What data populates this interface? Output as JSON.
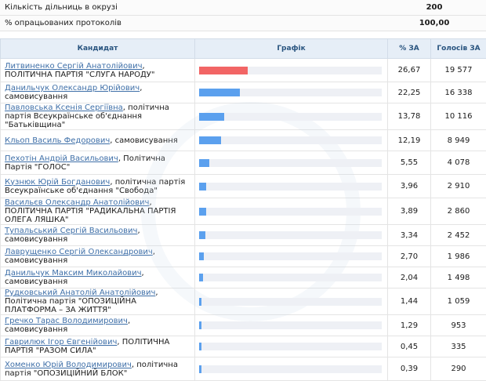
{
  "summary": [
    {
      "label": "Кількість дільниць в окрузі",
      "value": "200"
    },
    {
      "label": "% опрацьованих протоколів",
      "value": "100,00"
    }
  ],
  "table": {
    "headers": {
      "candidate": "Кандидат",
      "chart": "Графік",
      "pct": "% ЗА",
      "votes": "Голосів ЗА"
    },
    "rows": [
      {
        "name": "Литвиненко Сергій Анатолійович",
        "affil": ", ПОЛІТИЧНА ПАРТІЯ \"СЛУГА НАРОДУ\"",
        "pct": "26,67",
        "votes": "19 577",
        "share": 26.67
      },
      {
        "name": "Данильчук Олександр Юрійович",
        "affil": ", самовисування",
        "pct": "22,25",
        "votes": "16 338",
        "share": 22.25
      },
      {
        "name": "Павловська Ксенія Сергіївна",
        "affil": ", політична партія Всеукраїнське об'єднання \"Батьківщина\"",
        "pct": "13,78",
        "votes": "10 116",
        "share": 13.78
      },
      {
        "name": "Кльоп Василь Федорович",
        "affil": ", самовисування",
        "pct": "12,19",
        "votes": "8 949",
        "share": 12.19
      },
      {
        "name": "Пехотін Андрій Васильович",
        "affil": ", Політична Партія \"ГОЛОС\"",
        "pct": "5,55",
        "votes": "4 078",
        "share": 5.55
      },
      {
        "name": "Кузнюк Юрій Богданович",
        "affil": ", політична партія Всеукраїнське об'єднання \"Свобода\"",
        "pct": "3,96",
        "votes": "2 910",
        "share": 3.96
      },
      {
        "name": "Васильєв Олександр Анатолійович",
        "affil": ", ПОЛІТИЧНА ПАРТІЯ \"РАДИКАЛЬНА ПАРТІЯ ОЛЕГА ЛЯШКА\"",
        "pct": "3,89",
        "votes": "2 860",
        "share": 3.89
      },
      {
        "name": "Тупальський Сергій Васильович",
        "affil": ", самовисування",
        "pct": "3,34",
        "votes": "2 452",
        "share": 3.34
      },
      {
        "name": "Лаврущенко Сергій Олександрович",
        "affil": ", самовисування",
        "pct": "2,70",
        "votes": "1 986",
        "share": 2.7
      },
      {
        "name": "Данильчук Максим Миколайович",
        "affil": ", самовисування",
        "pct": "2,04",
        "votes": "1 498",
        "share": 2.04
      },
      {
        "name": "Рудковський Анатолій Анатолійович",
        "affil": ", Політична партія \"ОПОЗИЦІЙНА ПЛАТФОРМА – ЗА ЖИТТЯ\"",
        "pct": "1,44",
        "votes": "1 059",
        "share": 1.44
      },
      {
        "name": "Гречко Тарас Володимирович",
        "affil": ", самовисування",
        "pct": "1,29",
        "votes": "953",
        "share": 1.29
      },
      {
        "name": "Гаврилюк Ігор Євгенійович",
        "affil": ", ПОЛІТИЧНА ПАРТІЯ \"РАЗОМ СИЛА\"",
        "pct": "0,45",
        "votes": "335",
        "share": 0.45
      },
      {
        "name": "Хоменко Юрій Володимирович",
        "affil": ", політична партія \"ОПОЗИЦІЙНИЙ БЛОК\"",
        "pct": "0,39",
        "votes": "290",
        "share": 0.39
      }
    ]
  },
  "colors": {
    "leader_bar": "#f26565",
    "bar": "#5ba0ee",
    "header_bg": "#e6eef7",
    "link": "#3e6fa8"
  }
}
